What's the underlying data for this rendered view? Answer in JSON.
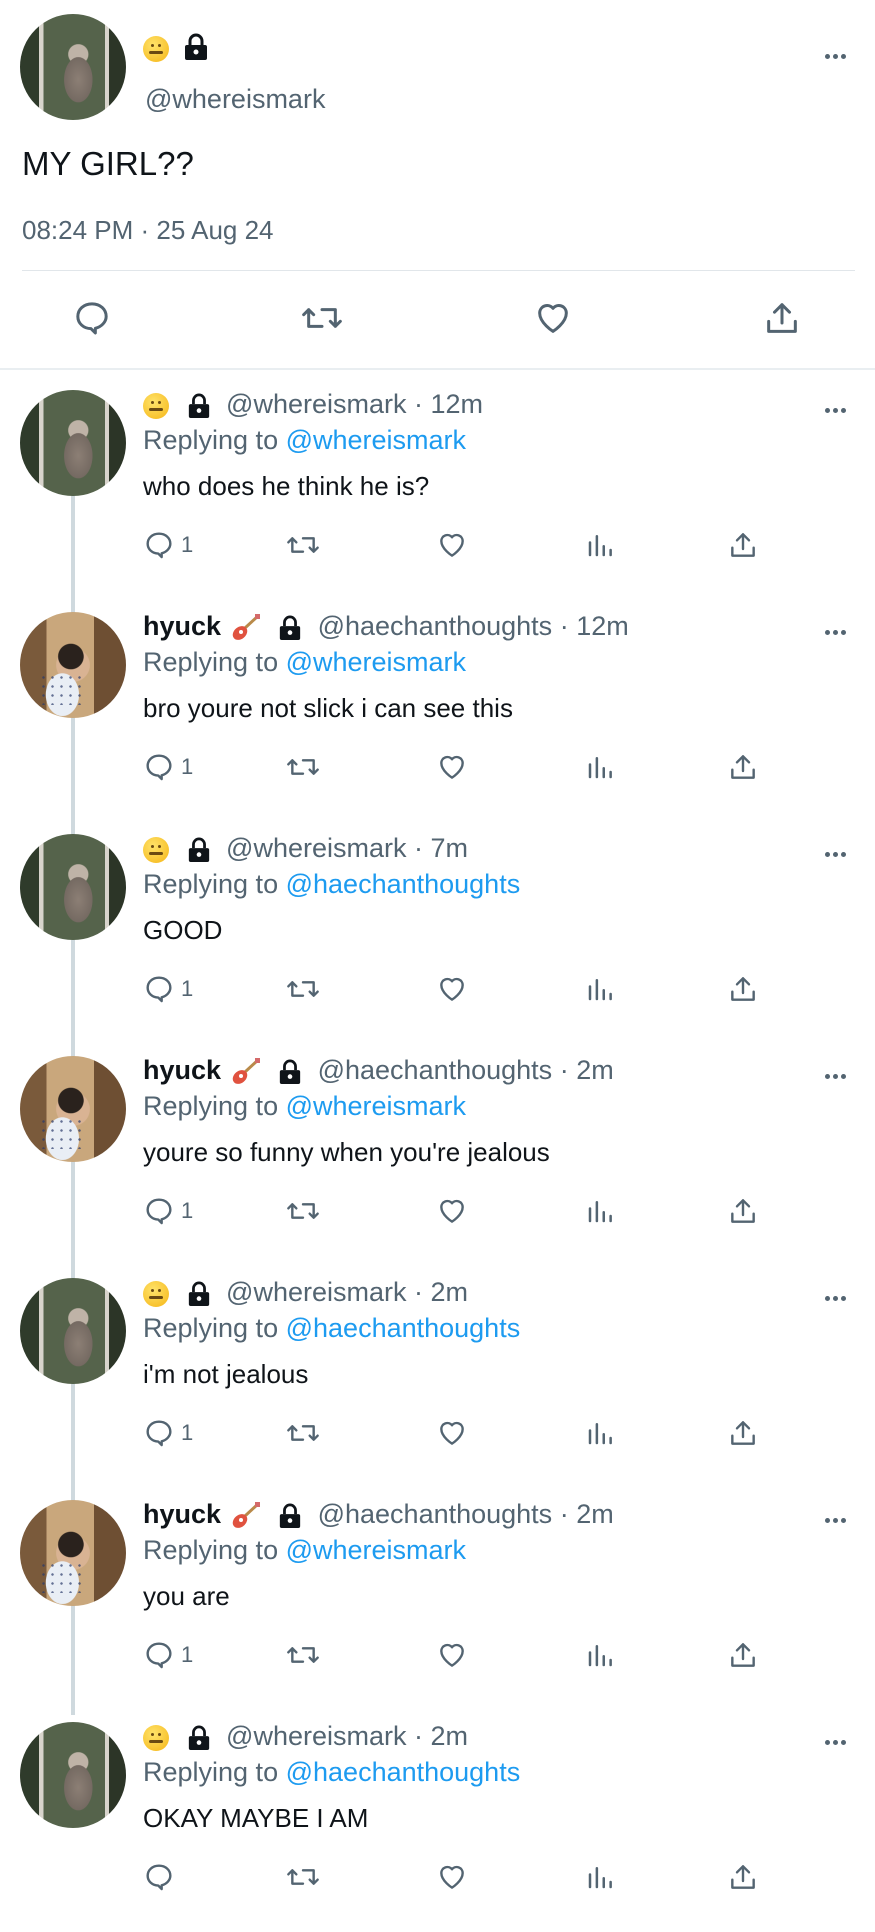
{
  "main_tweet": {
    "handle": "@whereismark",
    "text": "MY GIRL??",
    "timestamp": "08:24 PM · 25 Aug 24"
  },
  "replies": [
    {
      "author": "whereismark",
      "display_name": "",
      "handle": "@whereismark",
      "time": "12m",
      "replying_prefix": "Replying to",
      "replying_to": "@whereismark",
      "text": "who does he think he is?",
      "reply_count": "1"
    },
    {
      "author": "hyuck",
      "display_name": "hyuck",
      "handle": "@haechanthoughts",
      "time": "12m",
      "replying_prefix": "Replying to",
      "replying_to": "@whereismark",
      "text": "bro youre not slick i can see this",
      "reply_count": "1"
    },
    {
      "author": "whereismark",
      "display_name": "",
      "handle": "@whereismark",
      "time": "7m",
      "replying_prefix": "Replying to",
      "replying_to": "@haechanthoughts",
      "text": "GOOD",
      "reply_count": "1"
    },
    {
      "author": "hyuck",
      "display_name": "hyuck",
      "handle": "@haechanthoughts",
      "time": "2m",
      "replying_prefix": "Replying to",
      "replying_to": "@whereismark",
      "text": "youre so funny when you're jealous",
      "reply_count": "1"
    },
    {
      "author": "whereismark",
      "display_name": "",
      "handle": "@whereismark",
      "time": "2m",
      "replying_prefix": "Replying to",
      "replying_to": "@haechanthoughts",
      "text": "i'm not jealous",
      "reply_count": "1"
    },
    {
      "author": "hyuck",
      "display_name": "hyuck",
      "handle": "@haechanthoughts",
      "time": "2m",
      "replying_prefix": "Replying to",
      "replying_to": "@whereismark",
      "text": "you are",
      "reply_count": "1"
    },
    {
      "author": "whereismark",
      "display_name": "",
      "handle": "@whereismark",
      "time": "2m",
      "replying_prefix": "Replying to",
      "replying_to": "@haechanthoughts",
      "text": "OKAY MAYBE I AM",
      "reply_count": ""
    }
  ],
  "icons": {
    "reply": "reply-bubble-icon",
    "retweet": "retweet-icon",
    "like": "heart-icon",
    "analytics": "bar-chart-icon",
    "share": "share-icon",
    "more": "more-dots-icon",
    "lock": "lock-icon",
    "emoji": "zipper-mouth-face-emoji",
    "guitar": "guitar-emoji"
  },
  "colors": {
    "link": "#1d9bf0",
    "secondary": "#536471",
    "text": "#0f1419",
    "thread_line": "#cfd9de"
  }
}
